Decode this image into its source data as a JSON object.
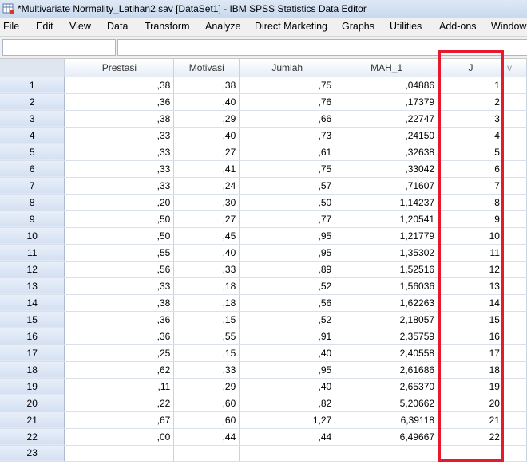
{
  "window": {
    "title": "*Multivariate Normality_Latihan2.sav [DataSet1] - IBM SPSS Statistics Data Editor"
  },
  "menu": [
    "File",
    "Edit",
    "View",
    "Data",
    "Transform",
    "Analyze",
    "Direct Marketing",
    "Graphs",
    "Utilities",
    "Add-ons",
    "Window"
  ],
  "grid": {
    "columns": [
      "Prestasi",
      "Motivasi",
      "Jumlah",
      "MAH_1",
      "J",
      "v"
    ],
    "rows": [
      {
        "n": "1",
        "c": [
          ",38",
          ",38",
          ",75",
          ",04886",
          "1"
        ]
      },
      {
        "n": "2",
        "c": [
          ",36",
          ",40",
          ",76",
          ",17379",
          "2"
        ]
      },
      {
        "n": "3",
        "c": [
          ",38",
          ",29",
          ",66",
          ",22747",
          "3"
        ]
      },
      {
        "n": "4",
        "c": [
          ",33",
          ",40",
          ",73",
          ",24150",
          "4"
        ]
      },
      {
        "n": "5",
        "c": [
          ",33",
          ",27",
          ",61",
          ",32638",
          "5"
        ]
      },
      {
        "n": "6",
        "c": [
          ",33",
          ",41",
          ",75",
          ",33042",
          "6"
        ]
      },
      {
        "n": "7",
        "c": [
          ",33",
          ",24",
          ",57",
          ",71607",
          "7"
        ]
      },
      {
        "n": "8",
        "c": [
          ",20",
          ",30",
          ",50",
          "1,14237",
          "8"
        ]
      },
      {
        "n": "9",
        "c": [
          ",50",
          ",27",
          ",77",
          "1,20541",
          "9"
        ]
      },
      {
        "n": "10",
        "c": [
          ",50",
          ",45",
          ",95",
          "1,21779",
          "10"
        ]
      },
      {
        "n": "11",
        "c": [
          ",55",
          ",40",
          ",95",
          "1,35302",
          "11"
        ]
      },
      {
        "n": "12",
        "c": [
          ",56",
          ",33",
          ",89",
          "1,52516",
          "12"
        ]
      },
      {
        "n": "13",
        "c": [
          ",33",
          ",18",
          ",52",
          "1,56036",
          "13"
        ]
      },
      {
        "n": "14",
        "c": [
          ",38",
          ",18",
          ",56",
          "1,62263",
          "14"
        ]
      },
      {
        "n": "15",
        "c": [
          ",36",
          ",15",
          ",52",
          "2,18057",
          "15"
        ]
      },
      {
        "n": "16",
        "c": [
          ",36",
          ",55",
          ",91",
          "2,35759",
          "16"
        ]
      },
      {
        "n": "17",
        "c": [
          ",25",
          ",15",
          ",40",
          "2,40558",
          "17"
        ]
      },
      {
        "n": "18",
        "c": [
          ",62",
          ",33",
          ",95",
          "2,61686",
          "18"
        ]
      },
      {
        "n": "19",
        "c": [
          ",11",
          ",29",
          ",40",
          "2,65370",
          "19"
        ]
      },
      {
        "n": "20",
        "c": [
          ",22",
          ",60",
          ",82",
          "5,20662",
          "20"
        ]
      },
      {
        "n": "21",
        "c": [
          ",67",
          ",60",
          "1,27",
          "6,39118",
          "21"
        ]
      },
      {
        "n": "22",
        "c": [
          ",00",
          ",44",
          ",44",
          "6,49667",
          "22"
        ]
      },
      {
        "n": "23",
        "c": [
          "",
          "",
          "",
          "",
          ""
        ]
      }
    ]
  },
  "colors": {
    "highlight": "#e8192c",
    "row_header": "#d4e0f1",
    "title_bar": "#c9d9ee"
  },
  "icons": {
    "app": "spss-data-editor-icon"
  }
}
